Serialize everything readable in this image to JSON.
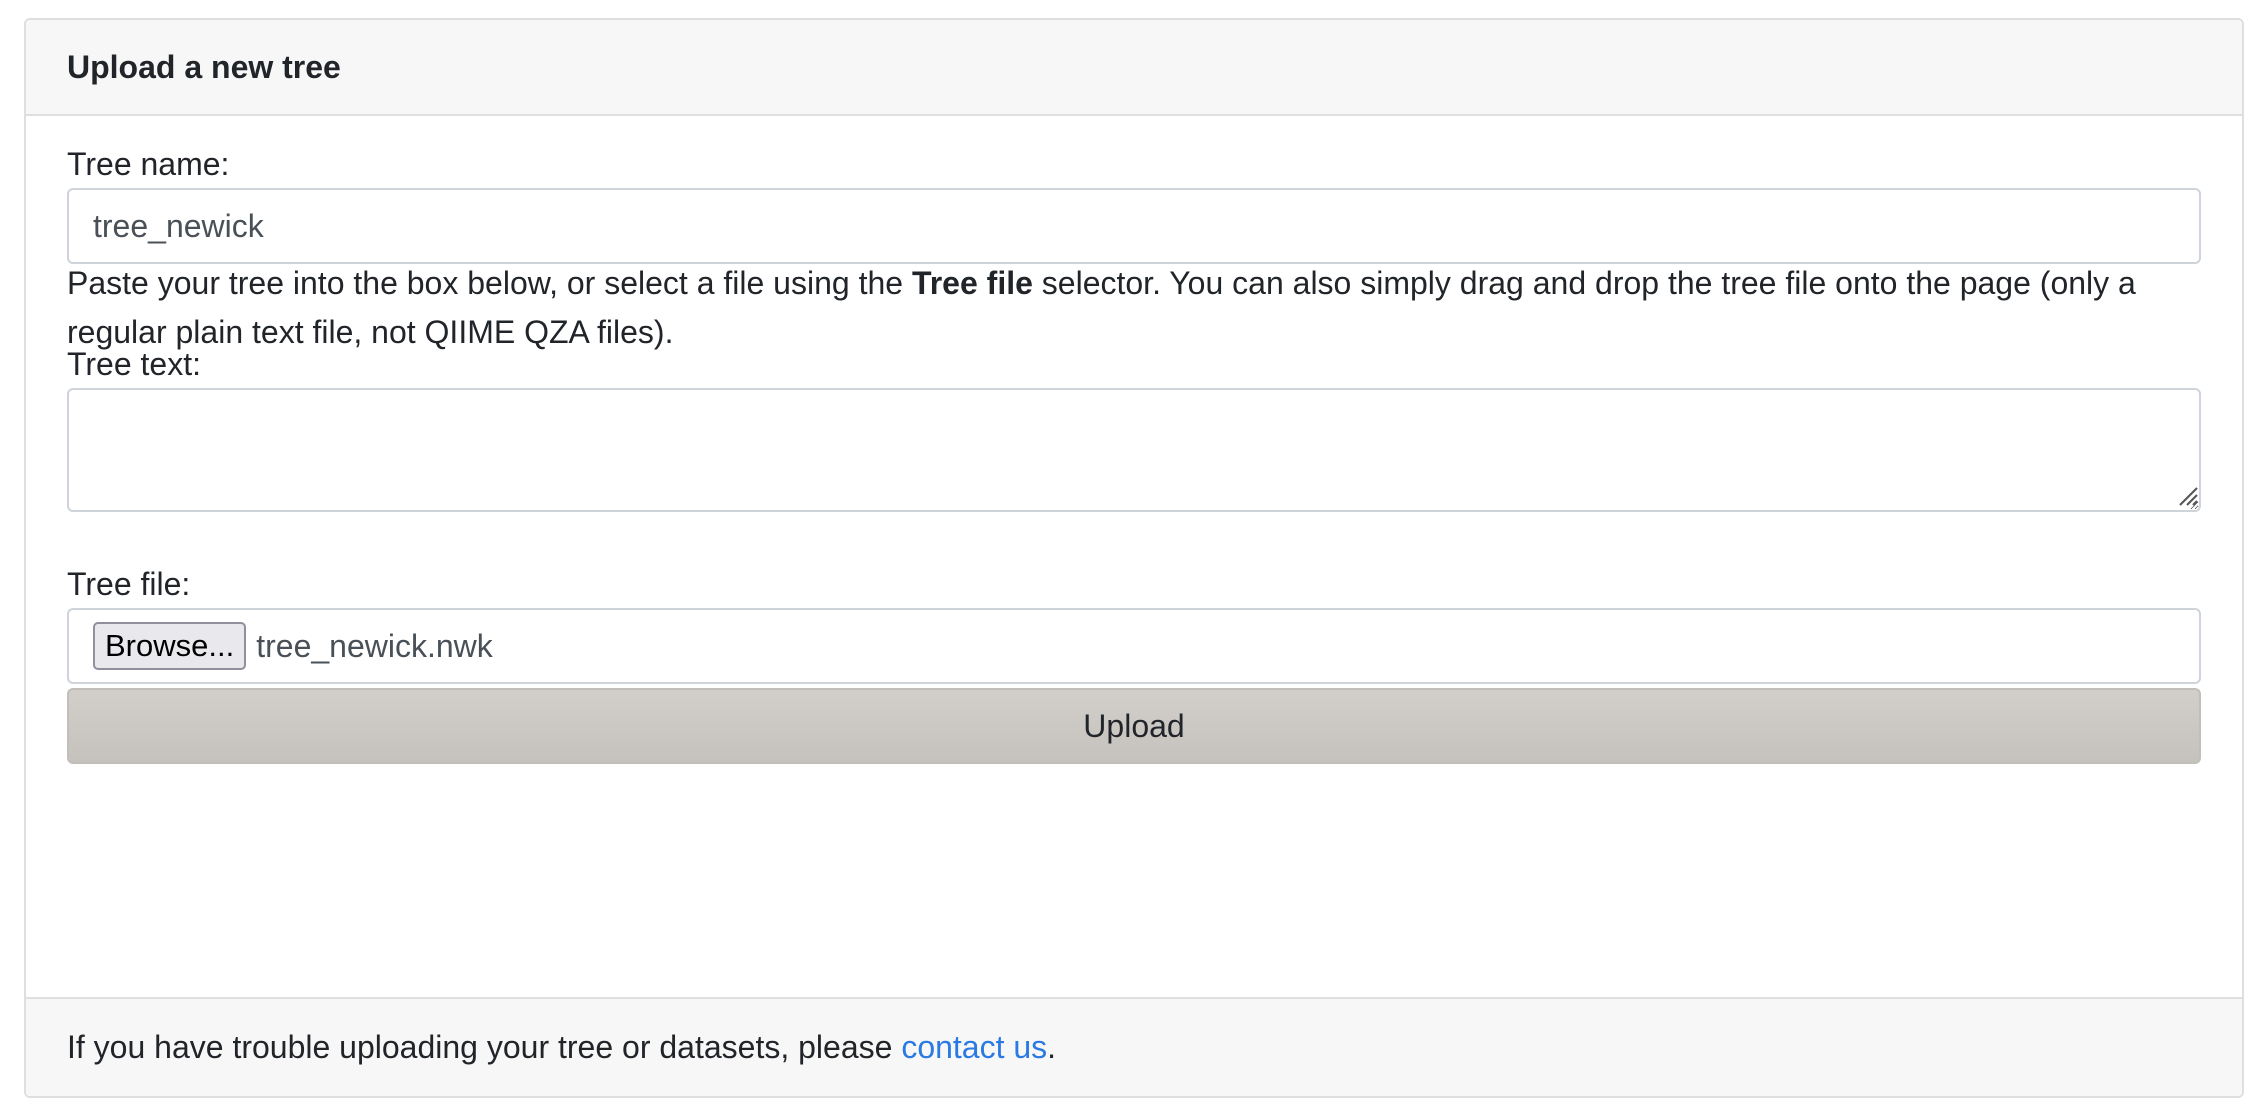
{
  "header": {
    "title": "Upload a new tree"
  },
  "form": {
    "tree_name": {
      "label": "Tree name:",
      "value": "tree_newick"
    },
    "help": {
      "before": "Paste your tree into the box below, or select a file using the ",
      "bold": "Tree file",
      "after": " selector. You can also simply drag and drop the tree file onto the page (only a regular plain text file, not QIIME QZA files)."
    },
    "tree_text": {
      "label": "Tree text:",
      "value": ""
    },
    "tree_file": {
      "label": "Tree file:",
      "browse_label": "Browse...",
      "file_name": "tree_newick.nwk"
    },
    "upload_label": "Upload"
  },
  "footer": {
    "text_before": "If you have trouble uploading your tree or datasets, please ",
    "link_text": "contact us",
    "text_after": "."
  },
  "colors": {
    "link": "#2a7ae2",
    "upload_button": "#c8c5c1",
    "card_header_bg": "#f7f7f7"
  }
}
